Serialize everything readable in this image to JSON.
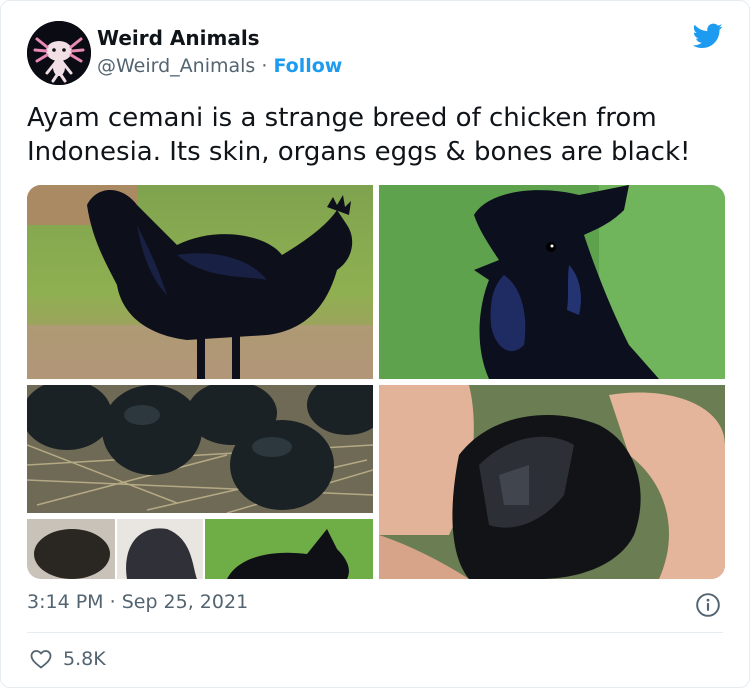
{
  "author": {
    "name": "Weird Animals",
    "handle": "@Weird_Animals",
    "separator": "·",
    "follow_label": "Follow"
  },
  "tweet": {
    "text": "Ayam cemani is a strange breed of chicken from Indonesia. Its skin, organs eggs & bones are black!"
  },
  "meta": {
    "time": "3:14 PM",
    "separator": "·",
    "date": "Sep 25, 2021"
  },
  "engagement": {
    "likes": "5.8K"
  },
  "icons": {
    "brand": "twitter-bird-icon",
    "info": "info-icon",
    "like": "heart-icon"
  },
  "colors": {
    "accent": "#1d9bf0",
    "text": "#0f1419",
    "secondary": "#536471"
  },
  "media": {
    "images": [
      "black-rooster-standing",
      "black-rooster-head",
      "black-eggs-nest",
      "black-rooster-beak-in-hand",
      "black-chicken-anatomy-collage"
    ]
  }
}
